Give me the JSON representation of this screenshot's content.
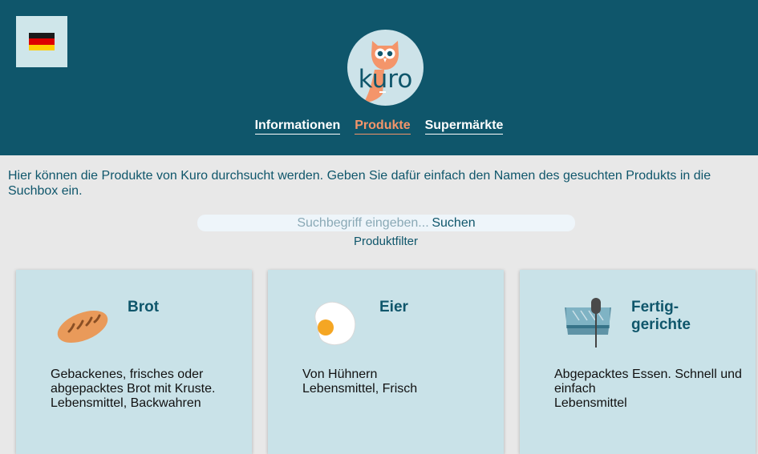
{
  "header": {
    "logo_text": "kuro",
    "flag_colors": [
      "#1a1a1a",
      "#dd0000",
      "#ffce00"
    ],
    "nav": [
      {
        "label": "Informationen",
        "active": false
      },
      {
        "label": "Produkte",
        "active": true
      },
      {
        "label": "Supermärkte",
        "active": false
      }
    ]
  },
  "intro": "Hier können die Produkte von Kuro durchsucht werden. Geben Sie dafür einfach den Namen des gesuchten Produkts in die Suchbox ein.",
  "search": {
    "placeholder": "Suchbegriff eingeben...",
    "button_label": "Suchen",
    "filter_label": "Produktfilter"
  },
  "cards": [
    {
      "title": "Brot",
      "description": "Gebackenes, frisches oder abgepacktes Brot mit Kruste.",
      "tags": "Lebensmittel, Backwahren",
      "icon": "bread-icon"
    },
    {
      "title": "Eier",
      "description": "Von Hühnern",
      "tags": "Lebensmittel, Frisch",
      "icon": "fried-egg-icon"
    },
    {
      "title": "Fertig-\ngerichte",
      "description": "Abgepacktes Essen. Schnell und einfach",
      "tags": "Lebensmittel",
      "icon": "ready-meal-icon"
    }
  ],
  "colors": {
    "header_bg": "#0f566b",
    "accent": "#f4956a",
    "card_bg": "#c9e2e8",
    "page_bg": "#e8e8e8"
  }
}
